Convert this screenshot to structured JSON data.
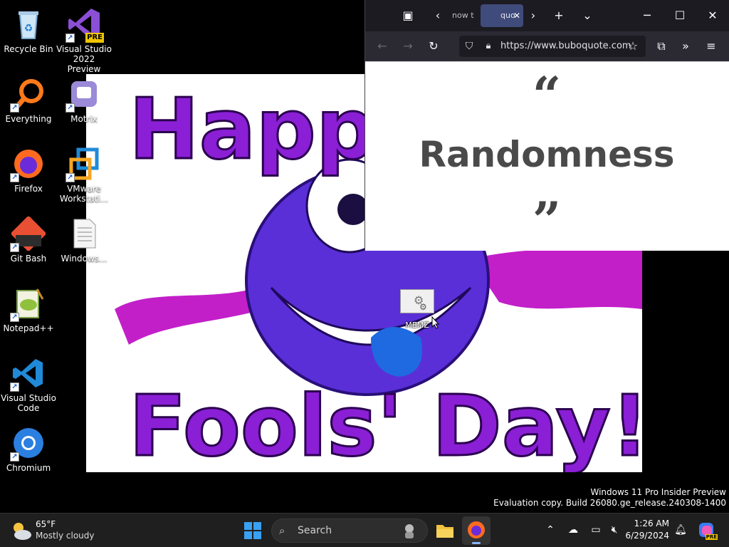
{
  "desktop": {
    "icons": [
      {
        "label": "Recycle Bin"
      },
      {
        "label": "Visual Studio 2022 Preview",
        "badge": "PRE"
      },
      {
        "label": "Everything"
      },
      {
        "label": "Motrix"
      },
      {
        "label": "Firefox"
      },
      {
        "label": "VMware Workstati..."
      },
      {
        "label": "Git Bash"
      },
      {
        "label": "Windows..."
      },
      {
        "label": "Notepad++"
      },
      {
        "label": "Visual Studio Code"
      },
      {
        "label": "Chromium"
      }
    ],
    "memz_label": "MEMZ",
    "wallpaper": {
      "line1": "Happy",
      "line2": "Fools' Day!"
    }
  },
  "browser": {
    "tabs": [
      {
        "label": "now t"
      },
      {
        "label": "quo"
      }
    ],
    "url": "https://www.buboquote.com",
    "quote": {
      "open_mark": "“",
      "text": "Randomness",
      "close_mark": "”"
    }
  },
  "watermark": {
    "line1": "Windows 11 Pro Insider Preview",
    "line2": "Evaluation copy. Build 26080.ge_release.240308-1400"
  },
  "taskbar": {
    "weather_temp": "65°F",
    "weather_desc": "Mostly cloudy",
    "search_label": "Search",
    "time": "1:26 AM",
    "date": "6/29/2024",
    "copilot_badge": "PRE"
  },
  "colors": {
    "taskbar_bg": "#1f1f1f",
    "browser_tabbar": "#1c1b22",
    "browser_navbar": "#2b2a33",
    "wallpaper_purple": "#8a1fd6",
    "quote_text": "#4a4a4a"
  }
}
